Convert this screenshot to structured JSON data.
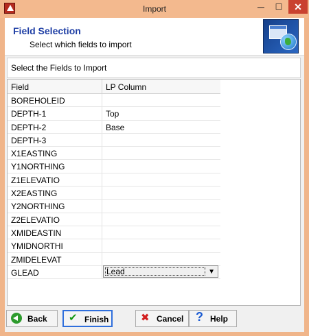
{
  "window": {
    "title": "Import"
  },
  "titlebar": {
    "minimize": "─",
    "maximize": "☐",
    "close": "✕"
  },
  "header": {
    "title": "Field Selection",
    "subtitle": "Select which fields to import"
  },
  "section": {
    "label": "Select the Fields to Import"
  },
  "grid": {
    "columns": [
      "Field",
      "LP Column"
    ],
    "rows": [
      {
        "field": "BOREHOLEID",
        "lp": ""
      },
      {
        "field": "DEPTH-1",
        "lp": "Top"
      },
      {
        "field": "DEPTH-2",
        "lp": "Base"
      },
      {
        "field": "DEPTH-3",
        "lp": ""
      },
      {
        "field": "X1EASTING",
        "lp": ""
      },
      {
        "field": "Y1NORTHING",
        "lp": ""
      },
      {
        "field": "Z1ELEVATIO",
        "lp": ""
      },
      {
        "field": "X2EASTING",
        "lp": ""
      },
      {
        "field": "Y2NORTHING",
        "lp": ""
      },
      {
        "field": "Z2ELEVATIO",
        "lp": ""
      },
      {
        "field": "XMIDEASTIN",
        "lp": ""
      },
      {
        "field": "YMIDNORTHI",
        "lp": ""
      },
      {
        "field": "ZMIDELEVAT",
        "lp": ""
      },
      {
        "field": "GLEAD",
        "lp": "Lead"
      }
    ]
  },
  "footer": {
    "back_label": "Back",
    "finish_label": "Finish",
    "cancel_label": "Cancel",
    "help_label": "Help"
  },
  "colors": {
    "title_accent": "#1f3fa5",
    "window_frame": "#f0b58a"
  }
}
